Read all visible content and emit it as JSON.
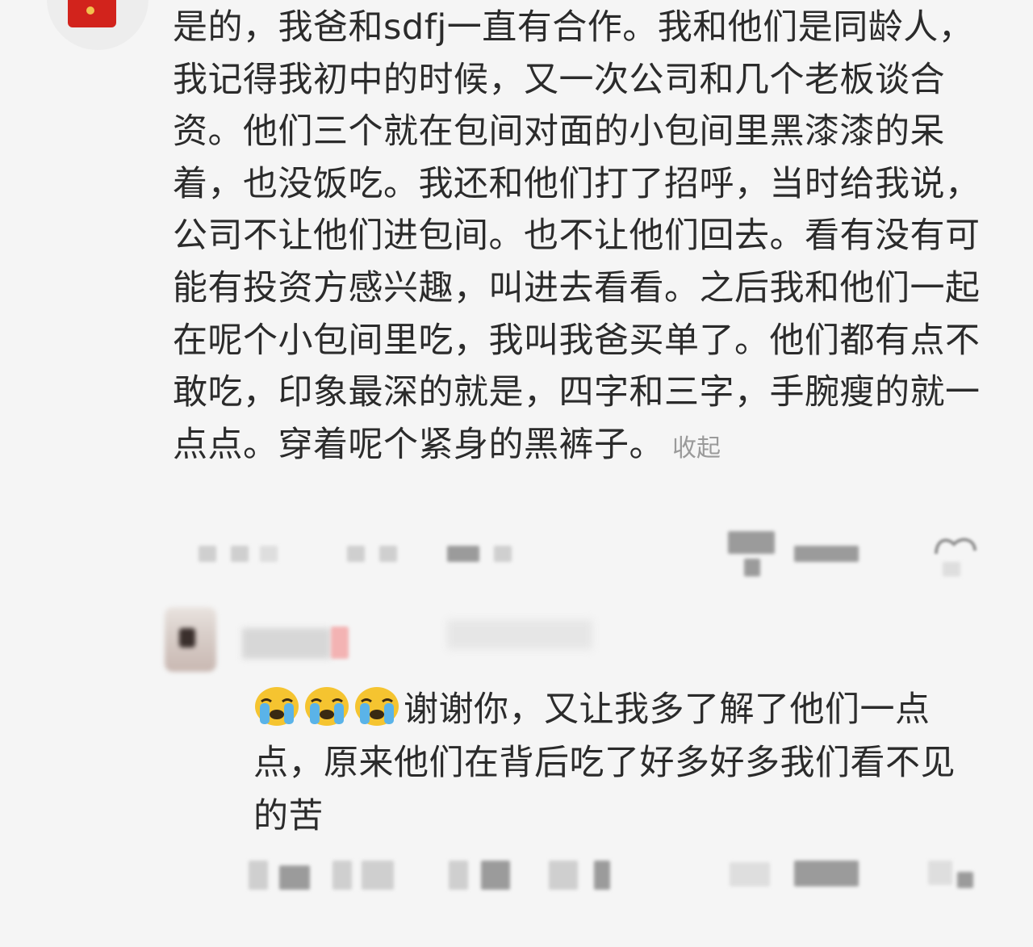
{
  "comment": {
    "text": "是的，我爸和sdfj一直有合作。我和他们是同龄人，我记得我初中的时候，又一次公司和几个老板谈合资。他们三个就在包间对面的小包间里黑漆漆的呆着，也没饭吃。我还和他们打了招呼，当时给我说，公司不让他们进包间。也不让他们回去。看有没有可能有投资方感兴趣，叫进去看看。之后我和他们一起在呢个小包间里吃，我叫我爸买单了。他们都有点不敢吃，印象最深的就是，四字和三字，手腕瘦的就一点点。穿着呢个紧身的黑裤子。",
    "collapse_label": "收起",
    "avatar_icon": "red-packet-icon"
  },
  "reply": {
    "emojis": [
      "crying-emoji",
      "crying-emoji",
      "crying-emoji"
    ],
    "text": "谢谢你，又让我多了解了他们一点点，原来他们在背后吃了好多好多我们看不见的苦"
  },
  "colors": {
    "background": "#f5f5f5",
    "text": "#2b2b2b",
    "muted": "#9a9a9a",
    "red_packet": "#d2231c",
    "emoji_yellow": "#f5c430",
    "emoji_tear": "#5ab3e8"
  }
}
